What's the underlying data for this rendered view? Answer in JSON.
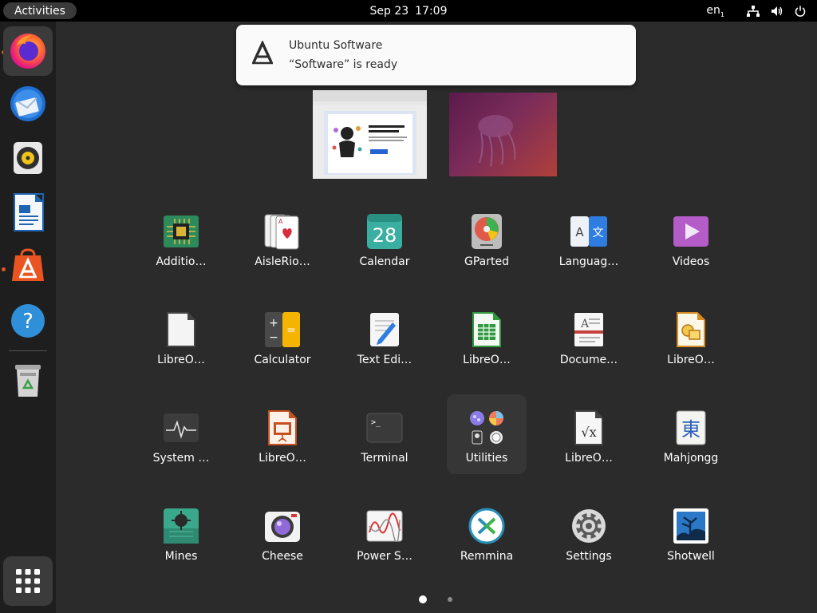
{
  "topbar": {
    "activities": "Activities",
    "date": "Sep 23",
    "time": "17:09",
    "lang": "en",
    "lang_sub": "1",
    "icons": [
      "network-icon",
      "volume-icon",
      "power-icon"
    ]
  },
  "dock": {
    "items": [
      {
        "name": "firefox",
        "icon": "firefox-icon",
        "running": true
      },
      {
        "name": "thunderbird",
        "icon": "thunderbird-icon",
        "running": false
      },
      {
        "name": "rhythmbox",
        "icon": "rhythmbox-icon",
        "running": false
      },
      {
        "name": "libreoffice-writer",
        "icon": "writer-icon",
        "running": false
      },
      {
        "name": "ubuntu-software",
        "icon": "software-icon",
        "running": true
      },
      {
        "name": "help",
        "icon": "help-icon",
        "running": false
      },
      {
        "name": "trash",
        "icon": "trash-icon",
        "running": false
      },
      {
        "name": "show-apps",
        "icon": "grid-icon",
        "running": false
      }
    ],
    "accent": "#e95420"
  },
  "notification": {
    "title": "Ubuntu Software",
    "body": "“Software” is ready"
  },
  "apps": [
    {
      "label": "Additio…",
      "icon": "chip-icon"
    },
    {
      "label": "AisleRio…",
      "icon": "cards-icon"
    },
    {
      "label": "Calendar",
      "icon": "calendar-icon",
      "badge": "28"
    },
    {
      "label": "GParted",
      "icon": "disk-icon"
    },
    {
      "label": "Languag…",
      "icon": "language-icon"
    },
    {
      "label": "Videos",
      "icon": "video-icon"
    },
    {
      "label": "LibreO…",
      "icon": "libreoffice-icon"
    },
    {
      "label": "Calculator",
      "icon": "calculator-icon"
    },
    {
      "label": "Text Edi…",
      "icon": "text-editor-icon"
    },
    {
      "label": "LibreO…",
      "icon": "calc-icon"
    },
    {
      "label": "Docume…",
      "icon": "document-viewer-icon"
    },
    {
      "label": "LibreO…",
      "icon": "draw-icon"
    },
    {
      "label": "System …",
      "icon": "system-monitor-icon"
    },
    {
      "label": "LibreO…",
      "icon": "impress-icon"
    },
    {
      "label": "Terminal",
      "icon": "terminal-icon"
    },
    {
      "label": "Utilities",
      "icon": "folder-icon",
      "folder": true
    },
    {
      "label": "LibreO…",
      "icon": "math-icon"
    },
    {
      "label": "Mahjongg",
      "icon": "mahjongg-icon",
      "glyph": "東"
    },
    {
      "label": "Mines",
      "icon": "mines-icon"
    },
    {
      "label": "Cheese",
      "icon": "cheese-icon"
    },
    {
      "label": "Power S…",
      "icon": "power-stats-icon"
    },
    {
      "label": "Remmina",
      "icon": "remmina-icon"
    },
    {
      "label": "Settings",
      "icon": "settings-icon"
    },
    {
      "label": "Shotwell",
      "icon": "shotwell-icon"
    }
  ],
  "pagination": {
    "current": 1,
    "total": 2
  }
}
